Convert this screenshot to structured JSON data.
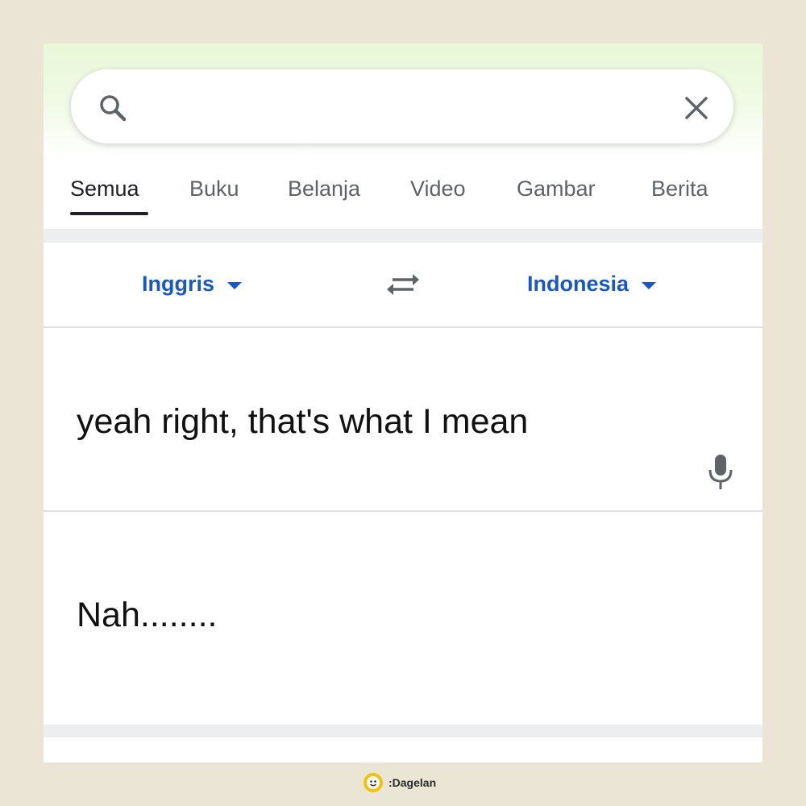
{
  "search": {
    "value": "",
    "placeholder": ""
  },
  "tabs": [
    {
      "label": "Semua",
      "active": true
    },
    {
      "label": "Buku"
    },
    {
      "label": "Belanja"
    },
    {
      "label": "Video"
    },
    {
      "label": "Gambar"
    },
    {
      "label": "Berita"
    }
  ],
  "translator": {
    "source_lang": "Inggris",
    "target_lang": "Indonesia",
    "source_text": "yeah right, that's what I mean",
    "result_text": "Nah........"
  },
  "watermark": {
    "text": ":Dagelan"
  },
  "colors": {
    "accent": "#1a57c6",
    "header_tint": "#e9f7d8",
    "page_background": "#ebe5d6"
  },
  "icons": [
    "search-icon",
    "close-icon",
    "swap-icon",
    "microphone-icon",
    "dagelan-logo"
  ]
}
